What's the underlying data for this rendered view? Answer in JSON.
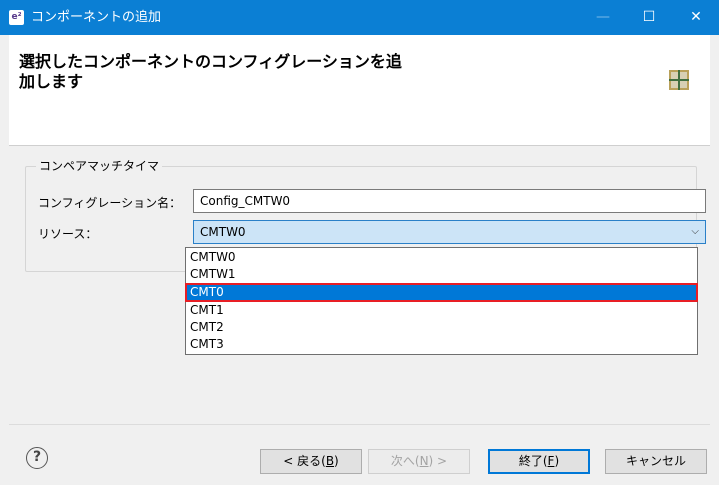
{
  "window": {
    "title": "コンポーネントの追加",
    "app_icon_text": "e²",
    "minimize_glyph": "—",
    "maximize_glyph": "☐",
    "close_glyph": "✕"
  },
  "header": {
    "heading_line1": "選択したコンポーネントのコンフィグレーションを追",
    "heading_line2": "加します",
    "icon": "wizard-grid-icon"
  },
  "group": {
    "legend": "コンペアマッチタイマ",
    "config_name_label": "コンフィグレーション名：",
    "config_name_value": "Config_CMTW0",
    "resource_label": "リソース：",
    "resource_selected": "CMTW0",
    "resource_chevron": "⌵"
  },
  "dropdown": {
    "options": [
      "CMTW0",
      "CMTW1",
      "CMT0",
      "CMT1",
      "CMT2",
      "CMT3"
    ],
    "highlighted_index": 2,
    "highlight_color": "#0078d7",
    "annotation_color": "#e81e25"
  },
  "footer": {
    "help_icon": "help-icon",
    "help_glyph": "?",
    "back_label": "< 戻る(",
    "back_key": "B",
    "back_end": ")",
    "next_label": "次へ(",
    "next_key": "N",
    "next_end": ") >",
    "finish_label": "終了(",
    "finish_key": "F",
    "finish_end": ")",
    "cancel_label": "キャンセル"
  },
  "colors": {
    "titlebar": "#0b7fd4",
    "selection_field": "#cce4f7"
  }
}
